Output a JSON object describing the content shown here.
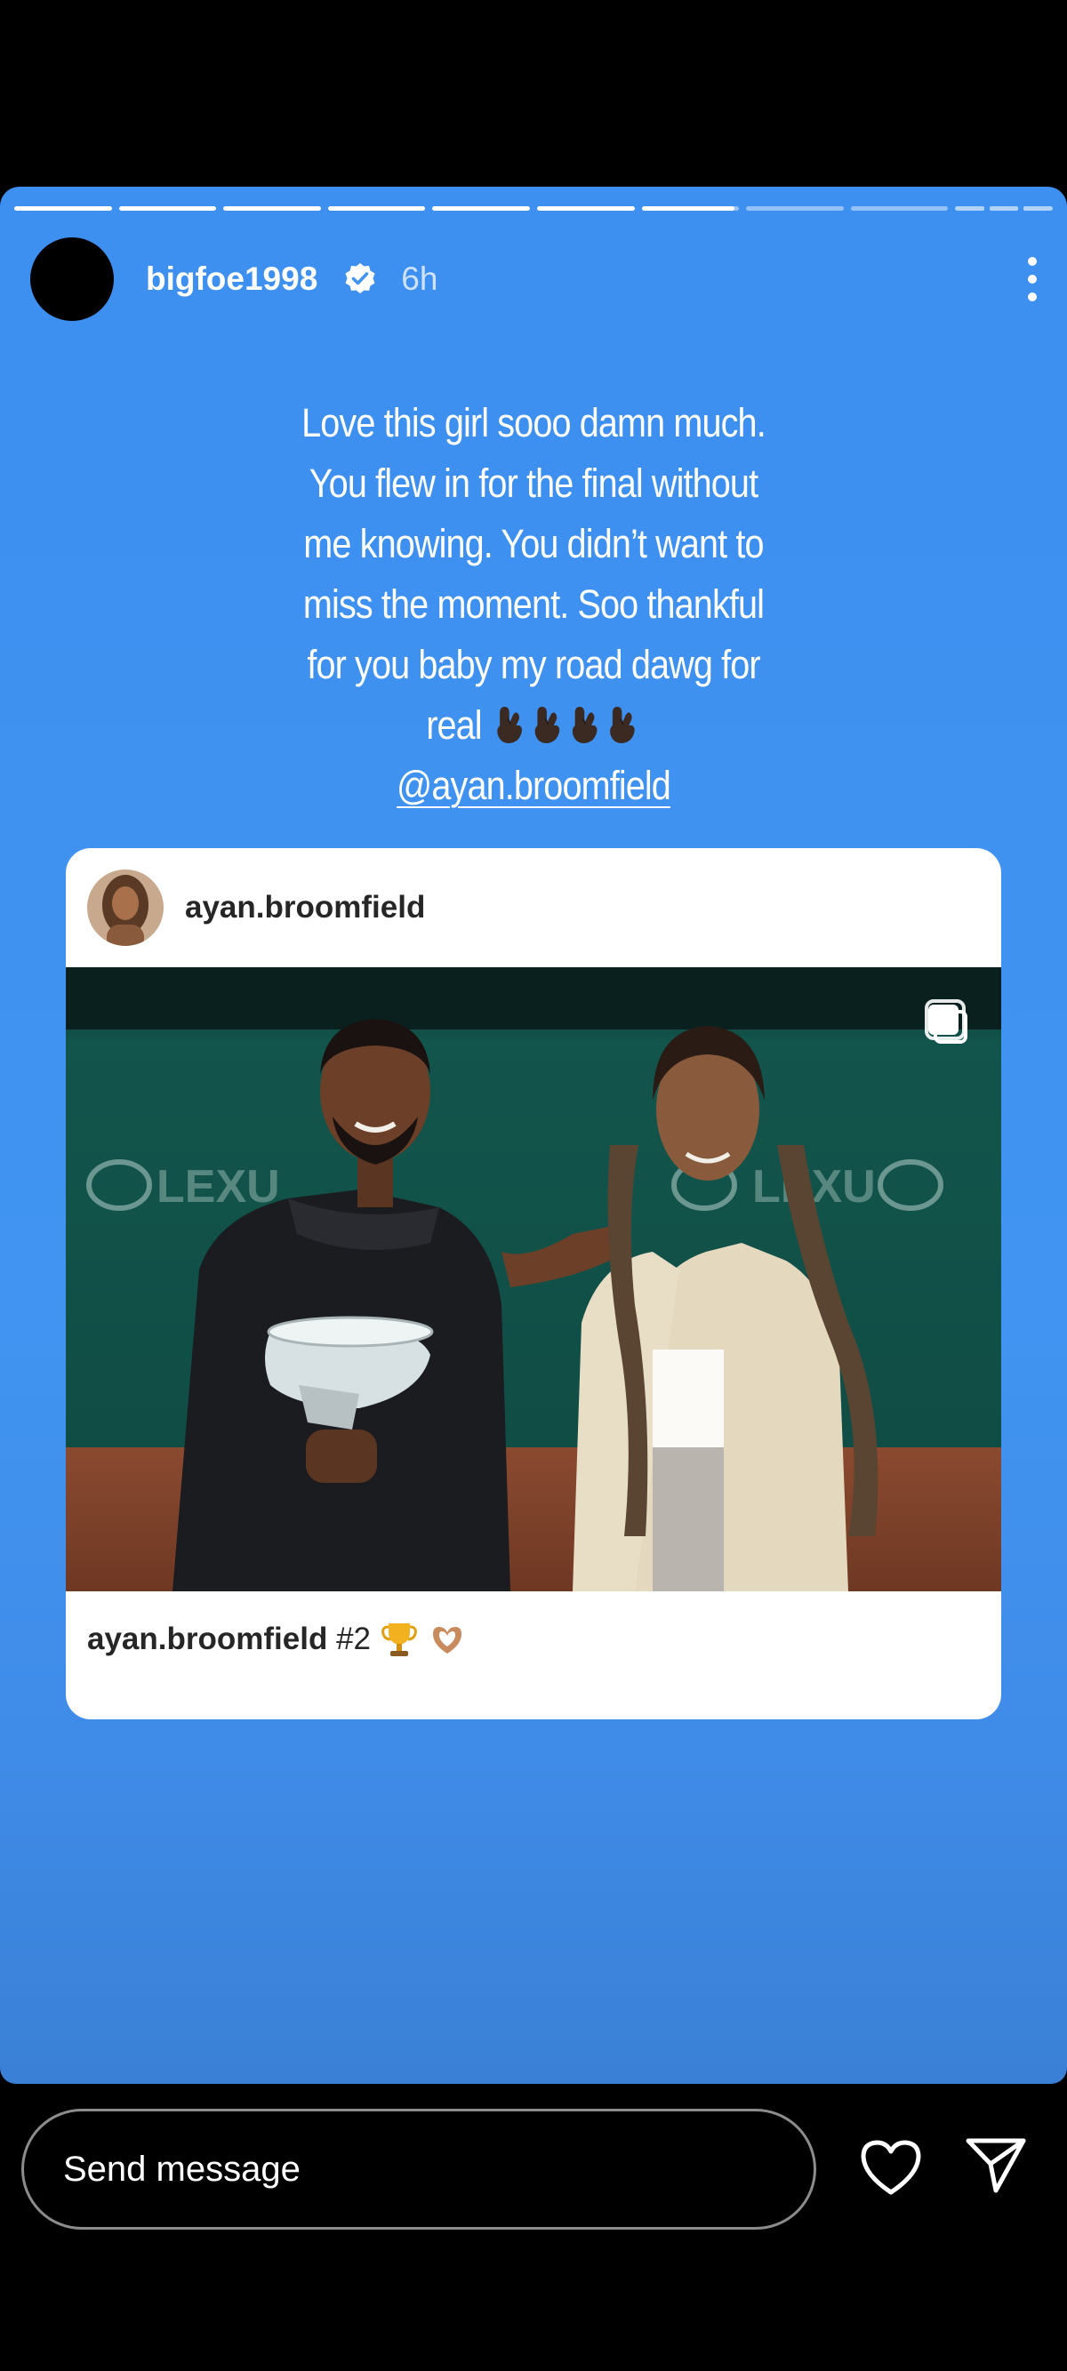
{
  "story": {
    "progress": {
      "segment_count": 10,
      "completed_segments": 6,
      "current_segment_fraction": 0.95,
      "dashed_trailing_segment": true
    },
    "background_color": "#4194f1",
    "header": {
      "username": "bigfoe1998",
      "verified": true,
      "time_ago": "6h"
    },
    "caption": {
      "lines": [
        "Love this girl sooo damn much.",
        "You flew in for the final without",
        "me knowing. You didn’t want to",
        "miss the moment. Soo thankful",
        "for you baby my road dawg for",
        "real"
      ],
      "emoji": "crossed-fingers x4",
      "mention": "@ayan.broomfield"
    },
    "shared_post": {
      "username": "ayan.broomfield",
      "has_multiple_images": true,
      "caption_user": "ayan.broomfield",
      "caption_text": "#2",
      "caption_emoji": [
        "trophy",
        "heart-hands"
      ]
    }
  },
  "footer": {
    "message_placeholder": "Send message",
    "icons": [
      "heart-icon",
      "send-icon"
    ]
  }
}
